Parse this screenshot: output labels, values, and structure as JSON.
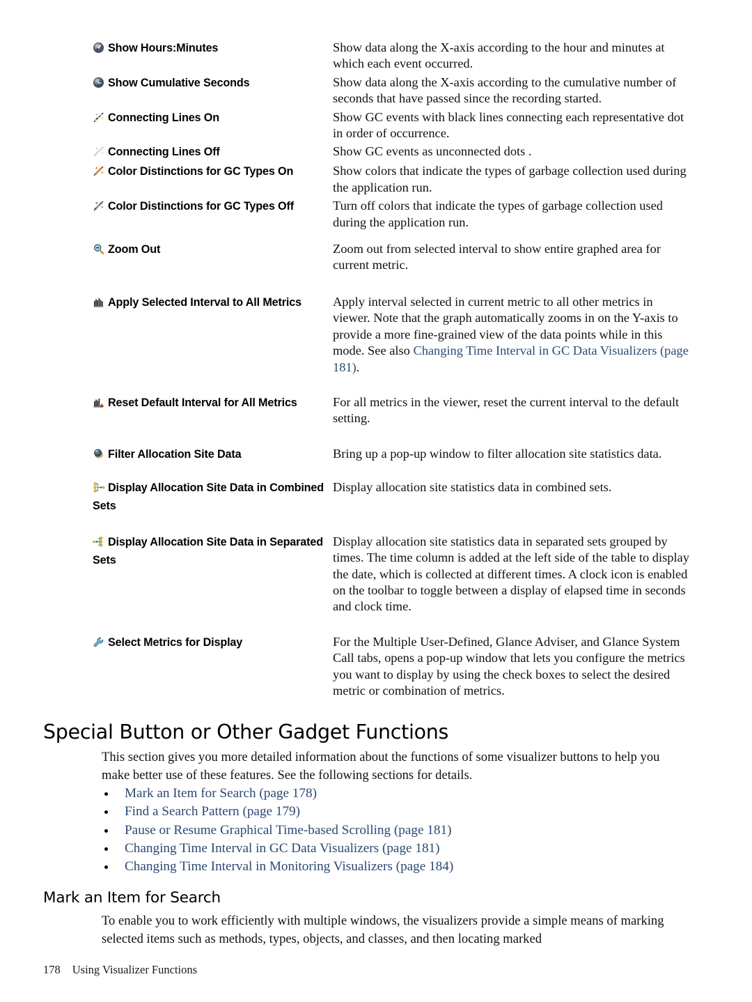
{
  "definition_rows": [
    {
      "icon": "clock-gauge-icon",
      "term": "Show Hours:Minutes",
      "description": "Show data along the X-axis according to the hour and minutes at which each event occurred."
    },
    {
      "icon": "clock-gauge-seconds-icon",
      "term": "Show Cumulative Seconds",
      "description": "Show data along the X-axis according to the cumulative number of seconds that have passed since the recording started."
    },
    {
      "icon": "connecting-lines-on-icon",
      "term": "Connecting Lines On",
      "description": "Show GC events with black lines connecting each representative dot in order of occurrence."
    },
    {
      "icon": "connecting-lines-off-icon",
      "term": "Connecting Lines Off",
      "description": "Show GC events as unconnected dots ."
    },
    {
      "icon": "color-distinctions-on-icon",
      "term": "Color Distinctions for GC Types On",
      "description": "Show colors that indicate the types of garbage collection used during the application run."
    },
    {
      "icon": "color-distinctions-off-icon",
      "term": "Color Distinctions for GC Types Off",
      "description": "Turn off colors that indicate the types of garbage collection used during the application run."
    },
    {
      "icon": "zoom-out-icon",
      "term": "Zoom Out",
      "description": "Zoom out from selected interval to show entire graphed area for current metric."
    },
    {
      "icon": "apply-interval-bars-icon",
      "term": "Apply Selected Interval to All Metrics",
      "description_prefix": "Apply interval selected in current metric to all other metrics in viewer. Note that the graph automatically zooms in on the Y-axis to provide a more fine-grained view of the data points while in this mode. See also ",
      "description_link": "Changing Time Interval in GC Data Visualizers (page 181)",
      "description_suffix": "."
    },
    {
      "icon": "reset-interval-bars-icon",
      "term": "Reset Default Interval for All Metrics",
      "description": "For all metrics in the viewer, reset the current interval to the default setting."
    },
    {
      "icon": "filter-allocation-icon",
      "term": "Filter Allocation Site Data",
      "description": "Bring up a pop-up window to filter allocation site statistics data."
    },
    {
      "icon": "combined-sets-icon",
      "term": "Display Allocation Site Data in Combined Sets",
      "description": "Display allocation site statistics data in combined sets."
    },
    {
      "icon": "separated-sets-icon",
      "term": "Display Allocation Site Data in Separated Sets",
      "description": "Display allocation site statistics data in separated sets grouped by times. The time column is added at the left side of the table to display the date, which is collected at different times. A clock icon is enabled on the toolbar to toggle between a display of elapsed time in seconds and clock time."
    },
    {
      "icon": "wrench-icon",
      "term": "Select Metrics for Display",
      "description": "For the Multiple User-Defined, Glance Adviser, and Glance System Call tabs, opens a pop-up window that lets you configure the metrics you want to display by using the check boxes to select the desired metric or combination of metrics."
    }
  ],
  "section_special": {
    "heading": "Special Button or Other Gadget Functions",
    "intro": "This section gives you more detailed information about the functions of some visualizer buttons to help you make better use of these features. See the following sections for details.",
    "links": [
      "Mark an Item for Search (page 178)",
      "Find a Search Pattern (page 179)",
      "Pause or Resume Graphical Time-based Scrolling (page 181)",
      "Changing Time Interval in GC Data Visualizers (page 181)",
      "Changing Time Interval in Monitoring Visualizers (page 184)"
    ]
  },
  "section_mark_item": {
    "heading": "Mark an Item for Search",
    "paragraph": "To enable you to work efficiently with multiple windows, the visualizers provide a simple means of marking selected items such as methods, types, objects, and classes, and then locating marked"
  },
  "footer": {
    "page_number": "178",
    "chapter_title": "Using Visualizer Functions"
  },
  "colors": {
    "link": "#2c4a72",
    "text": "#000000",
    "background": "#ffffff"
  }
}
